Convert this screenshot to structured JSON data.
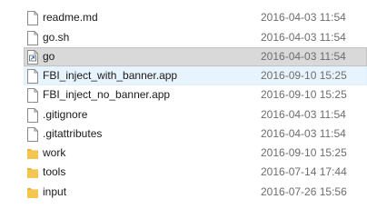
{
  "files": [
    {
      "name": "readme.md",
      "modified": "2016-04-03 11:54",
      "icon": "document-icon"
    },
    {
      "name": "go.sh",
      "modified": "2016-04-03 11:54",
      "icon": "document-icon"
    },
    {
      "name": "go",
      "modified": "2016-04-03 11:54",
      "icon": "shortcut-icon"
    },
    {
      "name": "FBI_inject_with_banner.app",
      "modified": "2016-09-10 15:25",
      "icon": "document-icon"
    },
    {
      "name": "FBI_inject_no_banner.app",
      "modified": "2016-09-10 15:25",
      "icon": "document-icon"
    },
    {
      "name": ".gitignore",
      "modified": "2016-04-03 11:54",
      "icon": "document-icon"
    },
    {
      "name": ".gitattributes",
      "modified": "2016-04-03 11:54",
      "icon": "document-icon"
    },
    {
      "name": "work",
      "modified": "2016-09-10 15:25",
      "icon": "folder-icon"
    },
    {
      "name": "tools",
      "modified": "2016-07-14 17:44",
      "icon": "folder-icon"
    },
    {
      "name": "input",
      "modified": "2016-07-26 15:56",
      "icon": "folder-icon"
    }
  ],
  "state": {
    "selected_row": "go",
    "hover_row": "FBI_inject_with_banner.app"
  },
  "colors": {
    "selected_bg": "#d9d9d9",
    "hover_bg": "#e8f4fd",
    "folder": "#f4c54f",
    "date_text": "#6d6d6d"
  }
}
